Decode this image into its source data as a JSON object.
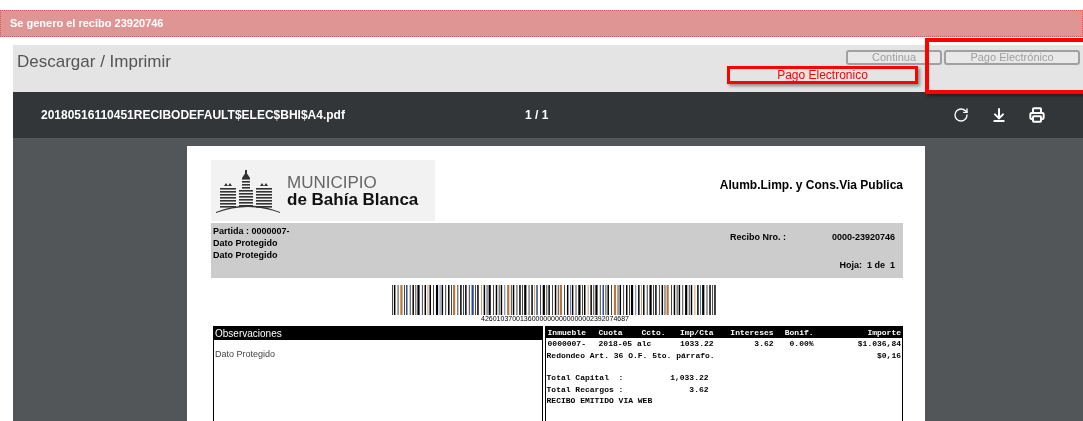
{
  "notification": {
    "text": "Se genero el recibo 23920746"
  },
  "panel": {
    "title": "Descargar / Imprimir",
    "buttons": [
      {
        "label": "Continua",
        "disabled": true
      },
      {
        "label": "Pago Electrónico",
        "disabled": true
      }
    ]
  },
  "annotation": {
    "text": "Pago Electronico"
  },
  "viewer": {
    "filename": "20180516110451RECIBODEFAULT$ELEC$BHI$A4.pdf",
    "page_counter": "1 / 1"
  },
  "document": {
    "logo": {
      "line_1": "MUNICIPIO",
      "line_2": "de Bahía Blanca"
    },
    "title": "Alumb.Limp. y Cons.Via Publica",
    "info_left": [
      "Partida : 0000007-",
      "Dato Protegido",
      "Dato Protegido"
    ],
    "recibo_label": "Recibo Nro. :",
    "recibo_value": "0000-23920746",
    "hoja": "Hoja:  1 de  1",
    "barcode_number": "42601037001360000000000000002392074687",
    "observaciones": {
      "header": "Observaciones",
      "text": "Dato Protegido"
    },
    "detail": {
      "columns": [
        "Inmueble",
        "Cuota",
        "Ccto.",
        "Imp/Cta",
        "Intereses",
        "Bonif.",
        "Importe"
      ],
      "rows": [
        {
          "cells": [
            "0000007-",
            "2018-05 alc",
            "",
            "1033.22",
            "3.62",
            "0.00%",
            "$1.036,84"
          ]
        }
      ],
      "redondeo": {
        "label": "Redondeo Art. 36 O.F. 5to. párrafo.",
        "amount": "$0,16"
      },
      "totals": [
        {
          "label": "Total Capital  :",
          "value": "1,033.22"
        },
        {
          "label": "Total Recargos :",
          "value": "3.62"
        }
      ],
      "footer": "RECIBO EMITIDO VIA WEB"
    }
  }
}
